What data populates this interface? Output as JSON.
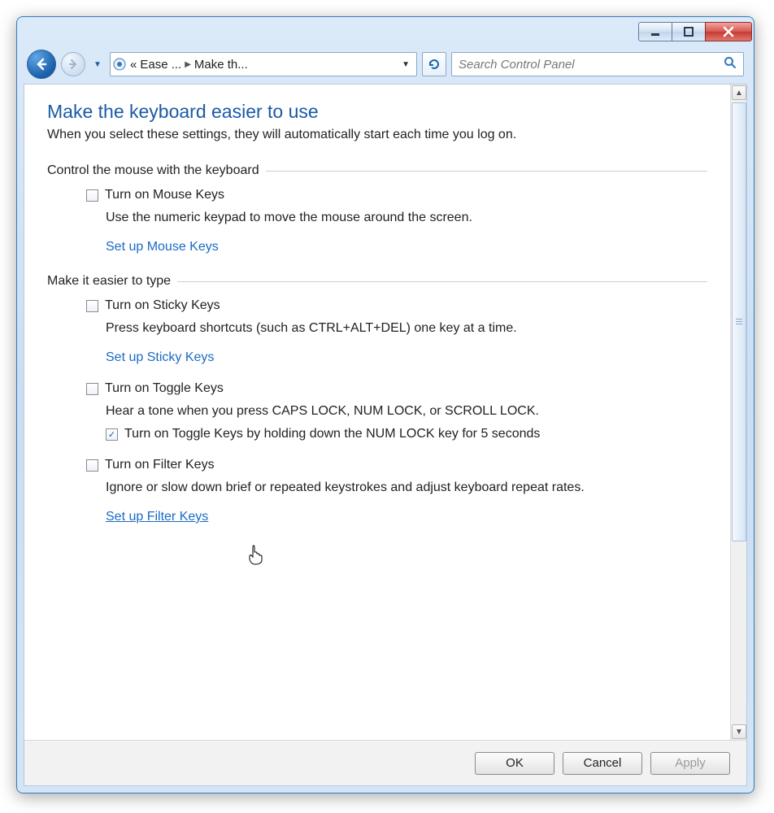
{
  "titlebar": {
    "minimize_tip": "Minimize",
    "maximize_tip": "Maximize",
    "close_tip": "Close"
  },
  "nav": {
    "back_tip": "Back",
    "forward_tip": "Forward",
    "breadcrumb_root": "Ease ...",
    "breadcrumb_current": "Make th...",
    "refresh_tip": "Refresh",
    "search_placeholder": "Search Control Panel"
  },
  "page": {
    "title": "Make the keyboard easier to use",
    "subtitle": "When you select these settings, they will automatically start each time you log on."
  },
  "group_mouse": {
    "heading": "Control the mouse with the keyboard",
    "check_label": "Turn on Mouse Keys",
    "checked": false,
    "desc": "Use the numeric keypad to move the mouse around the screen.",
    "link": "Set up Mouse Keys"
  },
  "group_type": {
    "heading": "Make it easier to type",
    "sticky": {
      "check_label": "Turn on Sticky Keys",
      "checked": false,
      "desc": "Press keyboard shortcuts (such as CTRL+ALT+DEL) one key at a time.",
      "link": "Set up Sticky Keys"
    },
    "toggle": {
      "check_label": "Turn on Toggle Keys",
      "checked": false,
      "desc": "Hear a tone when you press CAPS LOCK, NUM LOCK, or SCROLL LOCK.",
      "sub_check_label": "Turn on Toggle Keys by holding down the NUM LOCK key for 5 seconds",
      "sub_checked": true
    },
    "filter": {
      "check_label": "Turn on Filter Keys",
      "checked": false,
      "desc": "Ignore or slow down brief or repeated keystrokes and adjust keyboard repeat rates.",
      "link": "Set up Filter Keys"
    }
  },
  "footer": {
    "ok": "OK",
    "cancel": "Cancel",
    "apply": "Apply"
  }
}
